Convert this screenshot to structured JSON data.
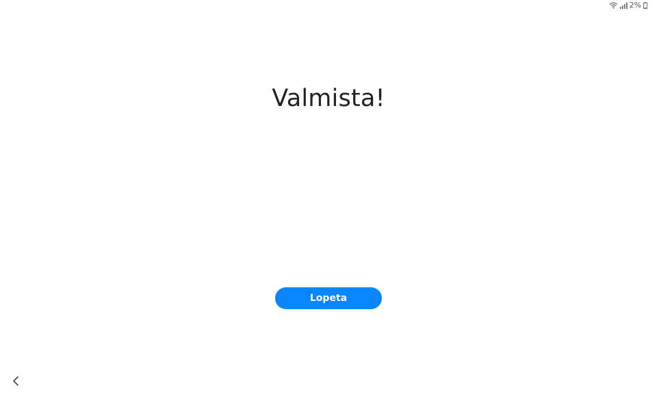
{
  "status_bar": {
    "battery_text": "2%",
    "icons": [
      "wifi-icon",
      "signal-icon",
      "battery-icon"
    ]
  },
  "main": {
    "title": "Valmista!",
    "finish_button_label": "Lopeta"
  },
  "navigation": {
    "back_icon": "chevron-left-icon"
  },
  "colors": {
    "accent": "#0a84ff",
    "title_text": "#222222",
    "background": "#ffffff"
  }
}
